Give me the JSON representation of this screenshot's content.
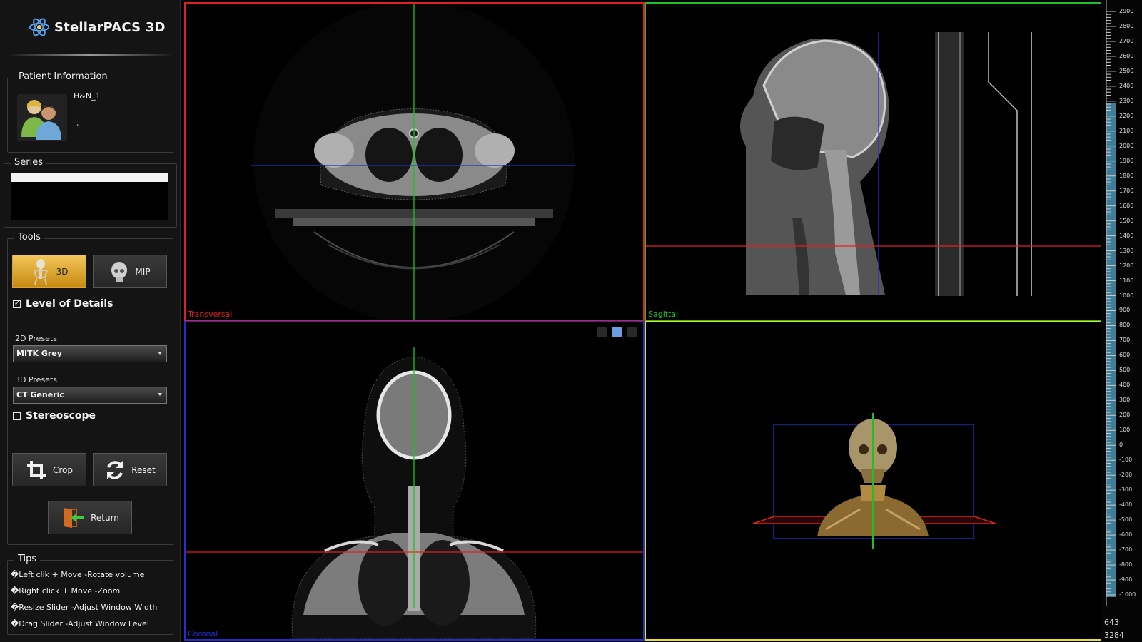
{
  "app": {
    "title": "StellarPACS 3D"
  },
  "patient": {
    "group_title": "Patient Information",
    "name": "H&N_1",
    "sub": ","
  },
  "series": {
    "group_title": "Series"
  },
  "tools": {
    "group_title": "Tools",
    "btn_3d": "3D",
    "btn_mip": "MIP",
    "level_of_details": "Level of Details",
    "level_of_details_checked": true,
    "presets_2d_label": "2D Presets",
    "presets_2d_value": "MITK Grey",
    "presets_3d_label": "3D Presets",
    "presets_3d_value": "CT Generic",
    "stereoscope": "Stereoscope",
    "stereoscope_checked": false,
    "crop": "Crop",
    "reset": "Reset",
    "return": "Return"
  },
  "tips": {
    "group_title": "Tips",
    "lines": [
      "�Left clik + Move -Rotate volume",
      "�Right click + Move -Zoom",
      "�Resize Slider -Adjust Window Width",
      "�Drag Slider -Adjust Window Level"
    ]
  },
  "views": {
    "transversal": "Transversal",
    "sagittal": "Sagittal",
    "coronal": "Coronal"
  },
  "colors": {
    "transversal": "#e02020",
    "sagittal": "#20c020",
    "coronal": "#2030d0",
    "render3d": "#e8e020",
    "accent": "#e6a92e"
  },
  "scale": {
    "ticks": [
      "2900",
      "2800",
      "2700",
      "2600",
      "2500",
      "2400",
      "2300",
      "2200",
      "2100",
      "2000",
      "1900",
      "1800",
      "1700",
      "1600",
      "1500",
      "1400",
      "1300",
      "1200",
      "1100",
      "1000",
      "900",
      "800",
      "700",
      "600",
      "500",
      "400",
      "300",
      "200",
      "100",
      "0",
      "-100",
      "-200",
      "-300",
      "-400",
      "-500",
      "-600",
      "-700",
      "-800",
      "-900",
      "-1000"
    ],
    "window_level": "643",
    "window_width": "3284"
  }
}
